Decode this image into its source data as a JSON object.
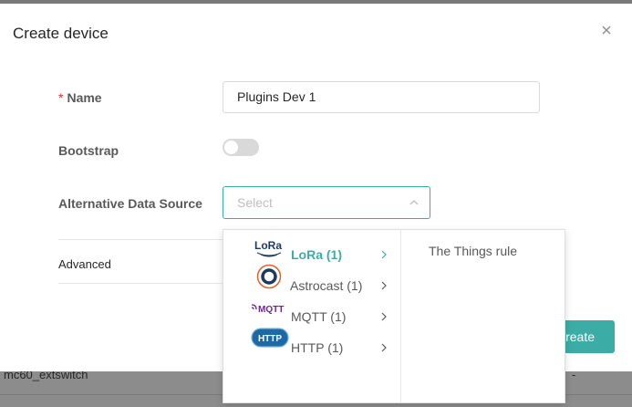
{
  "modal": {
    "title": "Create device"
  },
  "form": {
    "name_required_mark": "*",
    "name_label": "Name",
    "name_value": "Plugins Dev 1",
    "bootstrap_label": "Bootstrap",
    "bootstrap_enabled": false,
    "alt_source_label": "Alternative Data Source",
    "alt_source_placeholder": "Select",
    "advanced_label": "Advanced"
  },
  "create_button": {
    "label": "Create"
  },
  "dropdown": {
    "items": [
      {
        "label": "LoRa (1)",
        "logo_text": "LoRa",
        "active": true
      },
      {
        "label": "Astrocast (1)"
      },
      {
        "label": "MQTT (1)",
        "logo_text": "MQTT"
      },
      {
        "label": "HTTP (1)",
        "logo_text": "HTTP"
      }
    ],
    "sub_items": [
      {
        "label": "The Things rule"
      }
    ]
  },
  "background_row": {
    "name": "mc60_extswitch",
    "value": "-"
  },
  "colors": {
    "accent": "#3bada6",
    "required": "#f5222d",
    "mqtt_logo": "#6b2a8a",
    "http_logo": "#1b6aa5",
    "astrocast_ring": "#e0622d",
    "astrocast_core": "#1f3a5f"
  }
}
